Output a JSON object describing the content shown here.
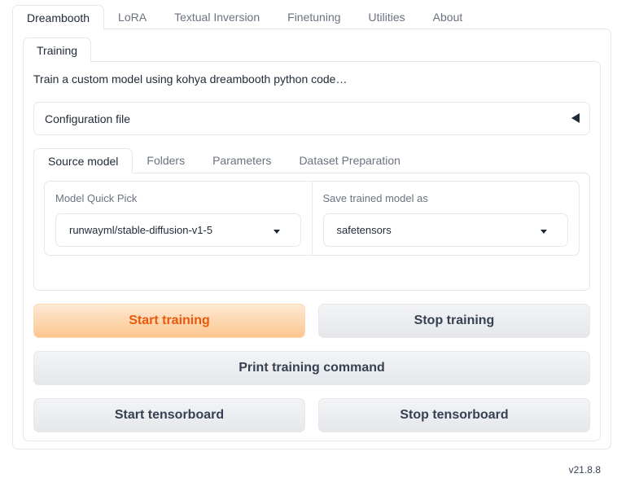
{
  "top_tabs": [
    "Dreambooth",
    "LoRA",
    "Textual Inversion",
    "Finetuning",
    "Utilities",
    "About"
  ],
  "inner_tab": "Training",
  "description": "Train a custom model using kohya dreambooth python code…",
  "config_accordion": {
    "label": "Configuration file"
  },
  "sub_tabs": [
    "Source model",
    "Folders",
    "Parameters",
    "Dataset Preparation"
  ],
  "model_quick_pick": {
    "label": "Model Quick Pick",
    "value": "runwayml/stable-diffusion-v1-5"
  },
  "save_model_as": {
    "label": "Save trained model as",
    "value": "safetensors"
  },
  "buttons": {
    "start_training": "Start training",
    "stop_training": "Stop training",
    "print_command": "Print training command",
    "start_tensorboard": "Start tensorboard",
    "stop_tensorboard": "Stop tensorboard"
  },
  "version": "v21.8.8",
  "colors": {
    "primary_text": "#ea580c",
    "primary_bg": "#fdc68e",
    "border": "#e5e7eb"
  }
}
